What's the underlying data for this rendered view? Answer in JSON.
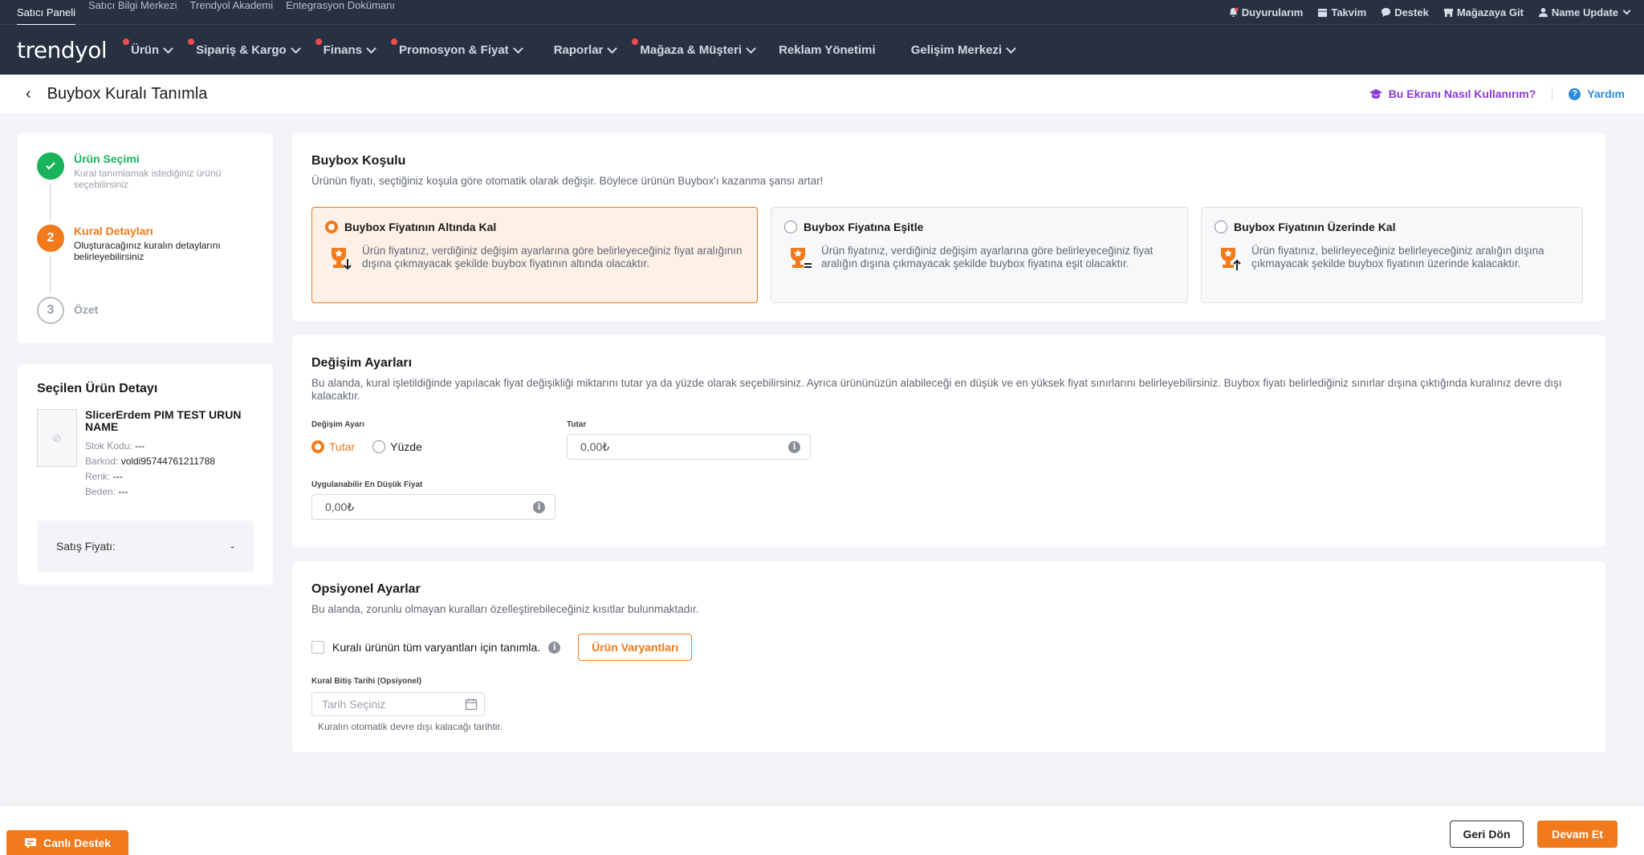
{
  "topbar": {
    "links": [
      "Satıcı Paneli",
      "Satıcı Bilgi Merkezi",
      "Trendyol Akademi",
      "Entegrasyon Dokümanı"
    ],
    "right": [
      "Duyurularım",
      "Takvim",
      "Destek",
      "Mağazaya Git",
      "Name Update"
    ]
  },
  "nav": {
    "logo": "trendyol",
    "items": [
      "Ürün",
      "Sipariş & Kargo",
      "Finans",
      "Promosyon & Fiyat",
      "Raporlar",
      "Mağaza & Müşteri",
      "Reklam Yönetimi",
      "Gelişim Merkezi"
    ]
  },
  "header": {
    "title": "Buybox Kuralı Tanımla",
    "howto": "Bu Ekranı Nasıl Kullanırım?",
    "help": "Yardım"
  },
  "steps": [
    {
      "number": "",
      "title": "Ürün Seçimi",
      "desc": "Kural tanımlamak istediğiniz ürünü seçebilirsiniz",
      "state": "done"
    },
    {
      "number": "2",
      "title": "Kural Detayları",
      "desc": "Oluşturacağınız kuralın detaylarını belirleyebilirsiniz",
      "state": "current"
    },
    {
      "number": "3",
      "title": "Özet",
      "desc": "",
      "state": "todo"
    }
  ],
  "product": {
    "heading": "Seçilen Ürün Detayı",
    "name": "SlicerErdem PIM TEST URUN NAME",
    "stock_label": "Stok Kodu:",
    "stock_value": "---",
    "barcode_label": "Barkod:",
    "barcode_value": "voldi95744761211788",
    "color_label": "Renk:",
    "color_value": "---",
    "size_label": "Beden:",
    "size_value": "---",
    "price_label": "Satış Fiyatı:",
    "price_value": "-"
  },
  "condition": {
    "title": "Buybox Koşulu",
    "desc": "Ürünün fiyatı, seçtiğiniz koşula göre otomatik olarak değişir. Böylece ürünün Buybox'ı kazanma şansı artar!",
    "options": [
      {
        "title": "Buybox Fiyatının Altında Kal",
        "text": "Ürün fiyatınız, verdiğiniz değişim ayarlarına göre belirleyeceğiniz fiyat aralığının dışına çıkmayacak şekilde buybox fiyatının altında olacaktır.",
        "selected": true
      },
      {
        "title": "Buybox Fiyatına Eşitle",
        "text": "Ürün fiyatınız, verdiğiniz değişim ayarlarına göre belirleyeceğiniz fiyat aralığın dışına çıkmayacak şekilde buybox fiyatına eşit olacaktır.",
        "selected": false
      },
      {
        "title": "Buybox Fiyatının Üzerinde Kal",
        "text": "Ürün fiyatınız, belirleyeceğiniz belirleyeceğiniz aralığın dışına çıkmayacak şekilde buybox fiyatının üzerinde kalacaktır.",
        "selected": false
      }
    ]
  },
  "change": {
    "title": "Değişim Ayarları",
    "desc": "Bu alanda, kural işletildiğinde yapılacak fiyat değişikliği miktarını tutar ya da yüzde olarak seçebilirsiniz. Ayrıca ürününüzün alabileceği en düşük ve en yüksek fiyat sınırlarını belirleyebilirsiniz. Buybox fiyatı belirlediğiniz sınırlar dışına çıktığında kuralınız devre dışı kalacaktır.",
    "type_label": "Değişim Ayarı",
    "opt_amount": "Tutar",
    "opt_percent": "Yüzde",
    "amount_label": "Tutar",
    "amount_value": "0,00₺",
    "min_label": "Uygulanabilir En Düşük Fiyat",
    "min_value": "0,00₺"
  },
  "optional": {
    "title": "Opsiyonel Ayarlar",
    "desc": "Bu alanda, zorunlu olmayan kuralları özelleştirebileceğiniz kısıtlar bulunmaktadır.",
    "checkbox_label": "Kuralı ürünün tüm varyantları için tanımla.",
    "variants_btn": "Ürün Varyantları",
    "date_label": "Kural Bitiş Tarihi (Opsiyonel)",
    "date_placeholder": "Tarih Seçiniz",
    "date_hint": "Kuralın otomatik devre dışı kalacağı tarihtir."
  },
  "footer": {
    "back": "Geri Dön",
    "next": "Devam Et",
    "live": "Canlı Destek"
  },
  "colors": {
    "accent": "#f27a1a",
    "nav_bg": "#273142",
    "success": "#19b35a",
    "purple": "#8a3ad6",
    "blue": "#2a8be0"
  }
}
